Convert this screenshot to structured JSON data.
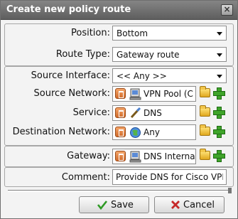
{
  "dialog": {
    "title": "Create new policy route",
    "close_label": "×"
  },
  "position": {
    "label": "Position:",
    "value": "Bottom"
  },
  "route_type": {
    "label": "Route Type:",
    "value": "Gateway route"
  },
  "source_interface": {
    "label": "Source Interface:",
    "value": "<< Any >>"
  },
  "source_network": {
    "label": "Source Network:",
    "value": "VPN Pool (C",
    "icon": "network-object-icon"
  },
  "service": {
    "label": "Service:",
    "value": "DNS",
    "icon": "service-icon"
  },
  "destination_network": {
    "label": "Destination Network:",
    "value": "Any",
    "icon": "globe-icon"
  },
  "gateway": {
    "label": "Gateway:",
    "value": "DNS Interna",
    "icon": "network-object-icon"
  },
  "comment": {
    "label": "Comment:",
    "value": "Provide DNS for Cisco VPN"
  },
  "buttons": {
    "save": "Save",
    "cancel": "Cancel"
  },
  "colors": {
    "titlebar": "#6e6e6e",
    "accent_green": "#3fa52a",
    "delete_orange": "#d06a2a",
    "cancel_red": "#c62828"
  }
}
